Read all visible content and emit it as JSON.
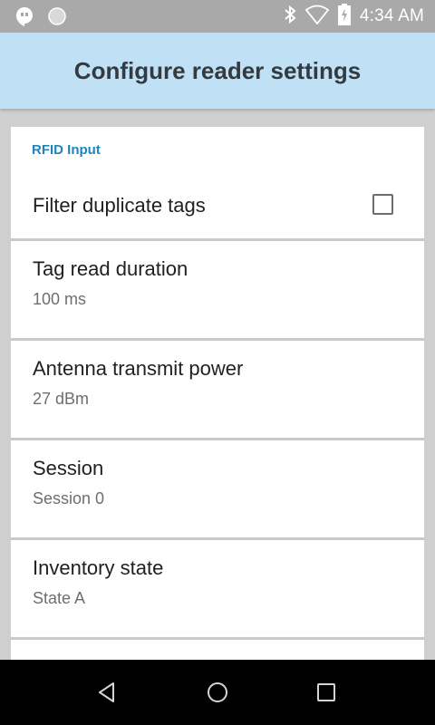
{
  "status_bar": {
    "time": "4:34 AM",
    "left_icons": [
      "hangouts-icon",
      "circle-icon"
    ],
    "right_icons": [
      "bluetooth-icon",
      "wifi-icon",
      "battery-charging-icon"
    ]
  },
  "app_bar": {
    "title": "Configure reader settings",
    "background": "#bfe0f5"
  },
  "section": {
    "header": "RFID Input",
    "header_color": "#1e84bd"
  },
  "settings": {
    "filter_duplicates": {
      "title": "Filter duplicate tags",
      "checked": false
    },
    "tag_read_duration": {
      "title": "Tag read duration",
      "summary": "100 ms"
    },
    "antenna_power": {
      "title": "Antenna transmit power",
      "summary": "27 dBm"
    },
    "session": {
      "title": "Session",
      "summary": "Session 0"
    },
    "inventory_state": {
      "title": "Inventory state",
      "summary": "State A"
    }
  },
  "nav_bar": {
    "buttons": [
      "back-icon",
      "home-icon",
      "recents-icon"
    ]
  }
}
